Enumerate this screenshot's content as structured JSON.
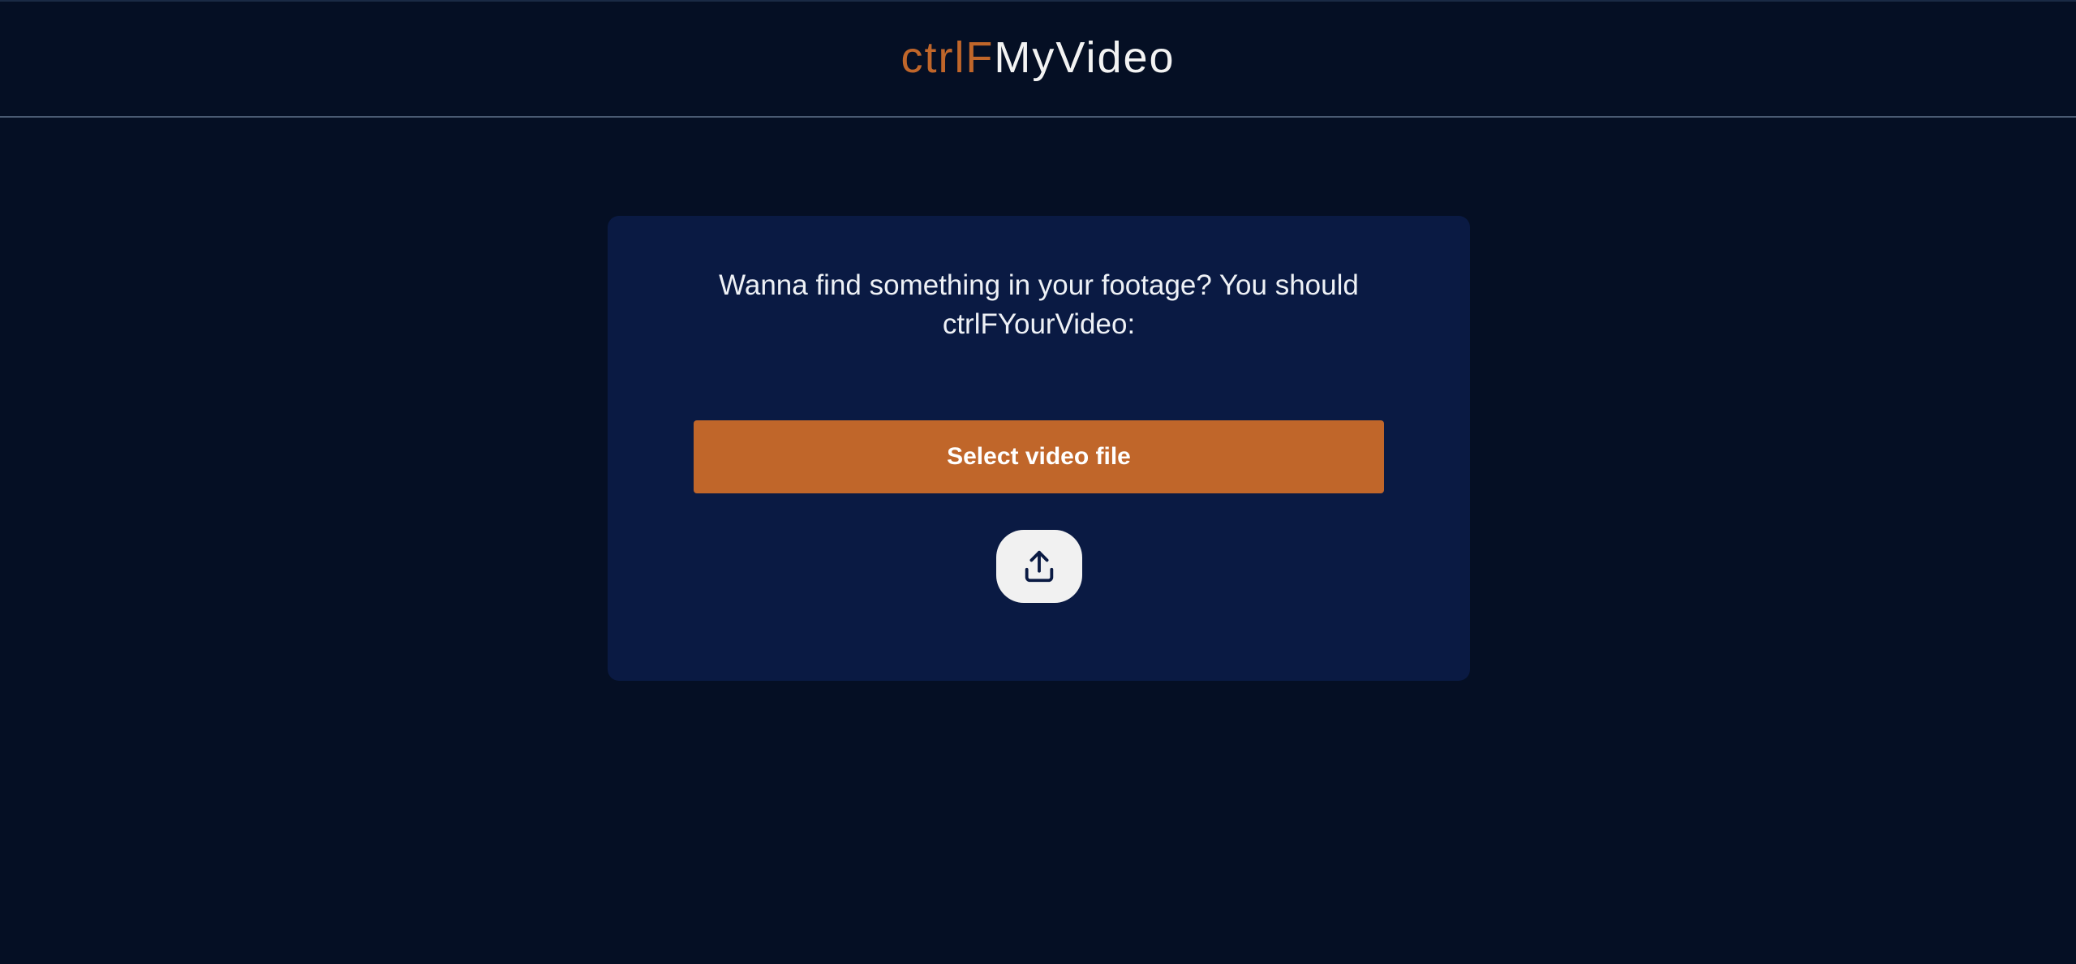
{
  "header": {
    "logo_accent": "ctrlF",
    "logo_main": "MyVideo"
  },
  "card": {
    "prompt": "Wanna find something in your footage? You should ctrlFYourVideo:",
    "select_button_label": "Select video file",
    "upload_icon": "upload-icon"
  },
  "colors": {
    "background": "#050f24",
    "card": "#0a1a43",
    "accent": "#c0662a",
    "upload_button": "#f1f1f1"
  }
}
